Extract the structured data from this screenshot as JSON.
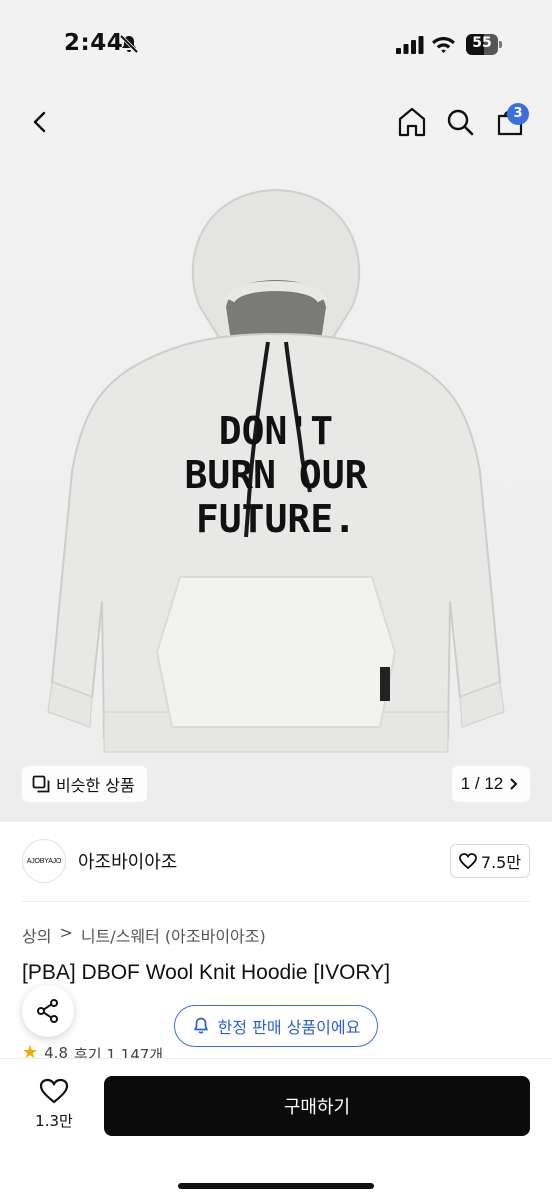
{
  "status_bar": {
    "time": "2:44",
    "battery_level": "55",
    "battery_fraction": 0.55,
    "icons": [
      "bell-off-icon",
      "signal-icon",
      "wifi-icon",
      "battery-icon"
    ]
  },
  "header": {
    "icons": [
      "back-icon",
      "home-icon",
      "search-icon",
      "cart-icon"
    ],
    "cart_count": "3",
    "accent_color": "#3b6fe0"
  },
  "gallery": {
    "similar_label": "비슷한 상품",
    "page_indicator": "1 / 12",
    "product_image": {
      "description_icon": "hoodie-image",
      "print_lines": [
        "DON'T",
        "BURN OUR",
        "FUTURE."
      ]
    }
  },
  "store": {
    "avatar_text": "AJOBYAJO",
    "name": "아조바이아조",
    "like_count": "7.5만"
  },
  "product": {
    "breadcrumb": [
      "상의",
      "니트/스웨터 (아조바이아조)"
    ],
    "title": "[PBA] DBOF Wool Knit Hoodie [IVORY]",
    "limited_label": "한정 판매 상품이에요",
    "rating": "4.8",
    "review_text": "후기 1,147개"
  },
  "bottom_bar": {
    "wish_count": "1.3만",
    "buy_label": "구매하기"
  }
}
